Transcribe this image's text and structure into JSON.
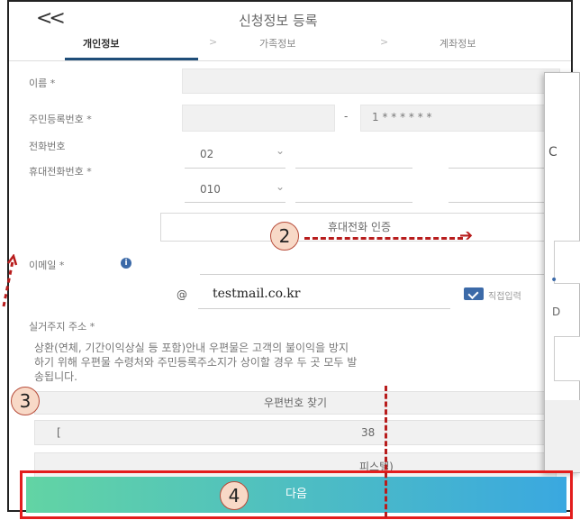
{
  "header": {
    "back": "<<",
    "title": "신청정보 등록"
  },
  "tabs": [
    {
      "label": "개인정보"
    },
    {
      "label": "가족정보"
    },
    {
      "label": "계좌정보"
    }
  ],
  "tab_separator": ">",
  "form": {
    "name_label": "이름 *",
    "rrn_label": "주민등록번호 *",
    "rrn_dash": "-",
    "rrn_back": "1 * * * * * *",
    "phone_label": "전화번호",
    "phone_area": "02",
    "mobile_label": "휴대전화번호 *",
    "mobile_prefix": "010",
    "mobile_verify": "휴대전화 인증",
    "email_label": "이메일 *",
    "email_at": "@",
    "email_domain": "testmail.co.kr",
    "email_check_label": "직접입력",
    "address_label": "실거주지 주소 *",
    "address_notice": "상환(연체, 기간이익상실 등 포함)안내 우편물은 고객의 불이익을 방지하기 위해 우편물 수령처와 주민등록주소지가 상이할 경우 두 곳 모두 발송됩니다.",
    "zip_button": "우편번호 찾기",
    "address_line1_left": "[",
    "address_line1_right": "38",
    "address_line2_right": "피스텔)"
  },
  "next_button": "다음",
  "overlay": {
    "char1": "C",
    "char2": "D",
    "bullet": "•"
  },
  "markers": [
    "2",
    "3",
    "4"
  ],
  "colors": {
    "accent": "#1f4e79",
    "highlight": "#e31d1d",
    "gradient_start": "#62d4a4",
    "gradient_end": "#3aa8e0"
  }
}
